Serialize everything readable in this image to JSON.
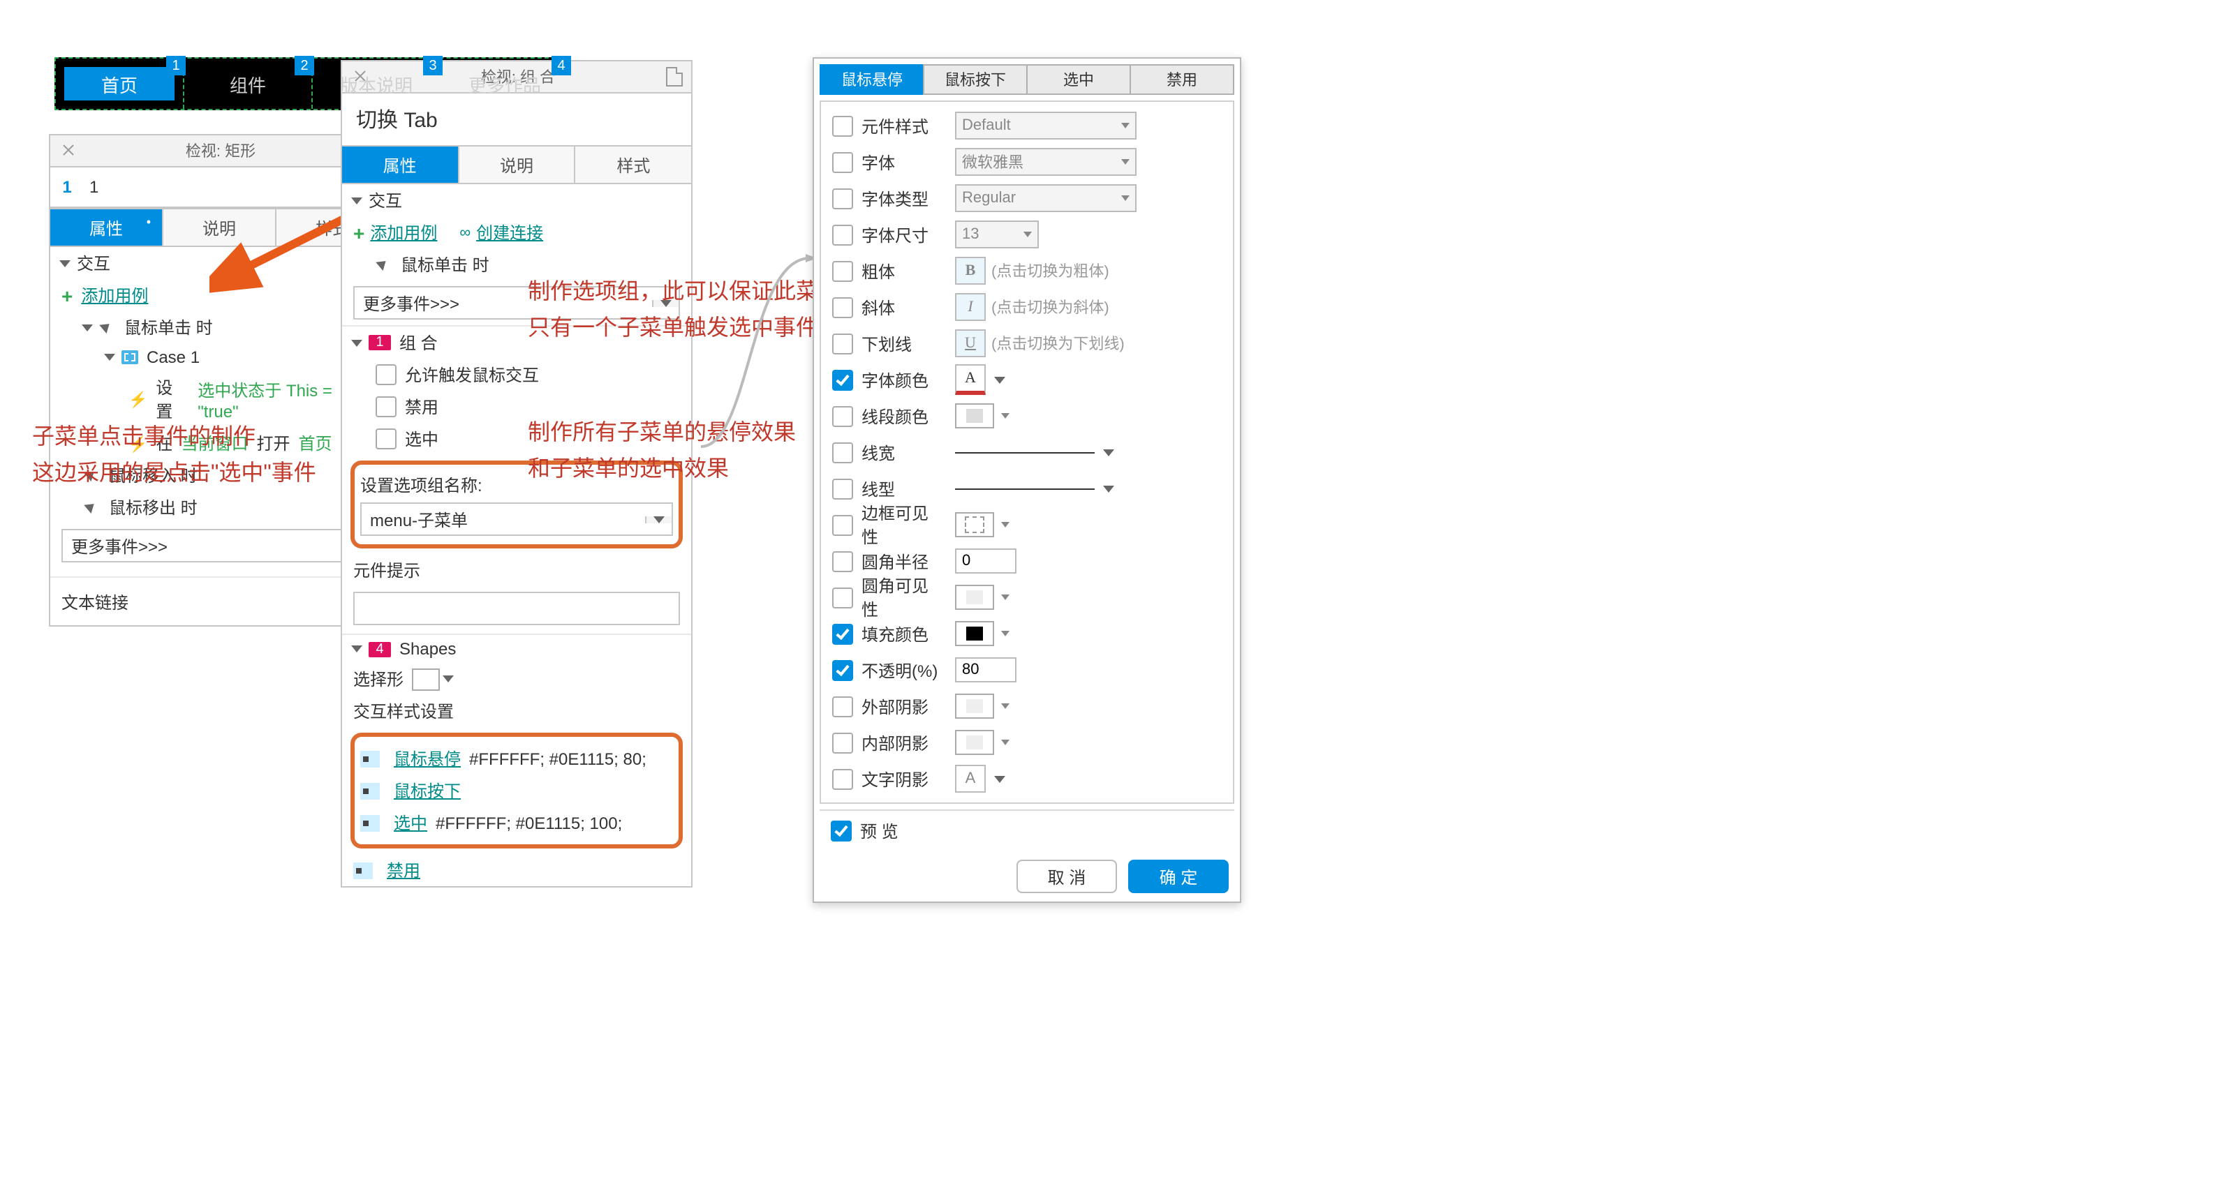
{
  "nav": {
    "tabs": [
      {
        "label": "首页",
        "num": "1",
        "active": true
      },
      {
        "label": "组件",
        "num": "2",
        "active": false
      },
      {
        "label": "版本说明",
        "num": "3",
        "active": false
      },
      {
        "label": "更多作品",
        "num": "4",
        "active": false
      }
    ]
  },
  "leftInspector": {
    "headerTitle": "检视: 矩形",
    "nameIndex": "1",
    "nameValue": "1",
    "tabs": [
      "属性",
      "说明",
      "样式"
    ],
    "activeTab": 0,
    "sectionInteractions": "交互",
    "addCase": "添加用例",
    "event_click": "鼠标单击 时",
    "case1": "Case 1",
    "action_set_prefix": "设置",
    "action_set_body": "选中状态于 This = \"true\"",
    "action_open_prefix": "在",
    "action_open_mid": "当前窗口",
    "action_open_verb": "打开",
    "action_open_target": "首页",
    "event_enter": "鼠标移入 时",
    "event_leave": "鼠标移出 时",
    "moreEvents": "更多事件>>>",
    "textLink": "文本链接"
  },
  "leftNote": {
    "line1": "子菜单点击事件的制作",
    "line2": "这边采用的是点击\"选中\"事件"
  },
  "midInspector": {
    "headerTitle": "检视: 组 合",
    "title": "切换 Tab",
    "tabs": [
      "属性",
      "说明",
      "样式"
    ],
    "activeTab": 0,
    "sectionInteractions": "交互",
    "addCase": "添加用例",
    "createLink": "创建连接",
    "event_click": "鼠标单击 时",
    "moreEvents": "更多事件>>>",
    "groupBadge": "1",
    "groupLabel": "组 合",
    "opt_allowMouse": "允许触发鼠标交互",
    "opt_disable": "禁用",
    "opt_select": "选中",
    "groupNameLabel": "设置选项组名称:",
    "groupNameValue": "menu-子菜单",
    "hintLabel": "元件提示",
    "shapesBadge": "4",
    "shapesLabel": "Shapes",
    "selectShape": "选择形",
    "styleSettings": "交互样式设置",
    "style_hover": "鼠标悬停",
    "style_hover_val": "#FFFFFF; #0E1115; 80;",
    "style_down": "鼠标按下",
    "style_selected": "选中",
    "style_selected_val": "#FFFFFF; #0E1115; 100;",
    "style_disabled": "禁用"
  },
  "midNote1": {
    "line1": "制作选项组，此可以保证此菜单组",
    "line2": "只有一个子菜单触发选中事件"
  },
  "midNote2": {
    "line1": "制作所有子菜单的悬停效果",
    "line2": "和子菜单的选中效果"
  },
  "dialog": {
    "tabs": [
      "鼠标悬停",
      "鼠标按下",
      "选中",
      "禁用"
    ],
    "activeTab": 0,
    "rows": {
      "widgetStyle": {
        "label": "元件样式",
        "value": "Default",
        "checked": false
      },
      "font": {
        "label": "字体",
        "value": "微软雅黑",
        "checked": false
      },
      "fontType": {
        "label": "字体类型",
        "value": "Regular",
        "checked": false
      },
      "fontSize": {
        "label": "字体尺寸",
        "value": "13",
        "checked": false
      },
      "bold": {
        "label": "粗体",
        "hint": "(点击切换为粗体)",
        "btn": "B",
        "checked": false
      },
      "italic": {
        "label": "斜体",
        "hint": "(点击切换为斜体)",
        "btn": "I",
        "checked": false
      },
      "underline": {
        "label": "下划线",
        "hint": "(点击切换为下划线)",
        "btn": "U",
        "checked": false
      },
      "fontColor": {
        "label": "字体颜色",
        "btn": "A",
        "checked": true
      },
      "lineColor": {
        "label": "线段颜色",
        "checked": false
      },
      "lineWidth": {
        "label": "线宽",
        "checked": false
      },
      "lineStyle": {
        "label": "线型",
        "checked": false
      },
      "borderVis": {
        "label": "边框可见性",
        "checked": false
      },
      "cornerRadius": {
        "label": "圆角半径",
        "value": "0",
        "checked": false
      },
      "cornerVis": {
        "label": "圆角可见性",
        "checked": false
      },
      "fillColor": {
        "label": "填充颜色",
        "swatch": "#000000",
        "checked": true
      },
      "opacity": {
        "label": "不透明(%)",
        "value": "80",
        "checked": true
      },
      "outerShadow": {
        "label": "外部阴影",
        "checked": false
      },
      "innerShadow": {
        "label": "内部阴影",
        "checked": false
      },
      "textShadow": {
        "label": "文字阴影",
        "checked": false
      }
    },
    "preview": "预 览",
    "previewChecked": true,
    "cancel": "取 消",
    "ok": "确 定"
  }
}
